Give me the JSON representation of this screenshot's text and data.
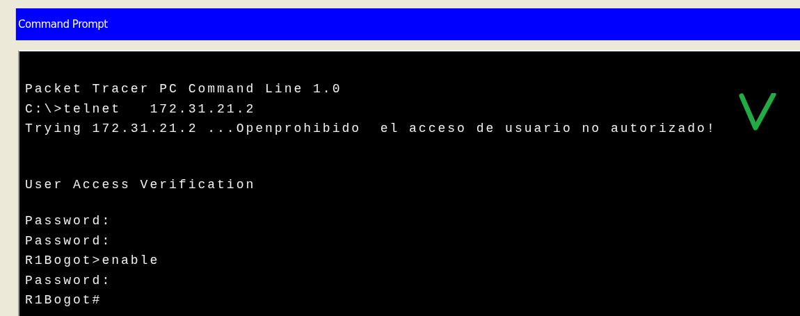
{
  "window": {
    "title": "Command Prompt"
  },
  "terminal": {
    "blocks": [
      [
        "Packet Tracer PC Command Line 1.0",
        "C:\\>telnet   172.31.21.2",
        "Trying 172.31.21.2 ...Openprohibido  el acceso de usuario no autorizado!"
      ],
      [
        "User Access Verification"
      ],
      [
        "Password:",
        "Password:",
        "R1Bogot>enable",
        "Password:",
        "R1Bogot#"
      ]
    ]
  }
}
